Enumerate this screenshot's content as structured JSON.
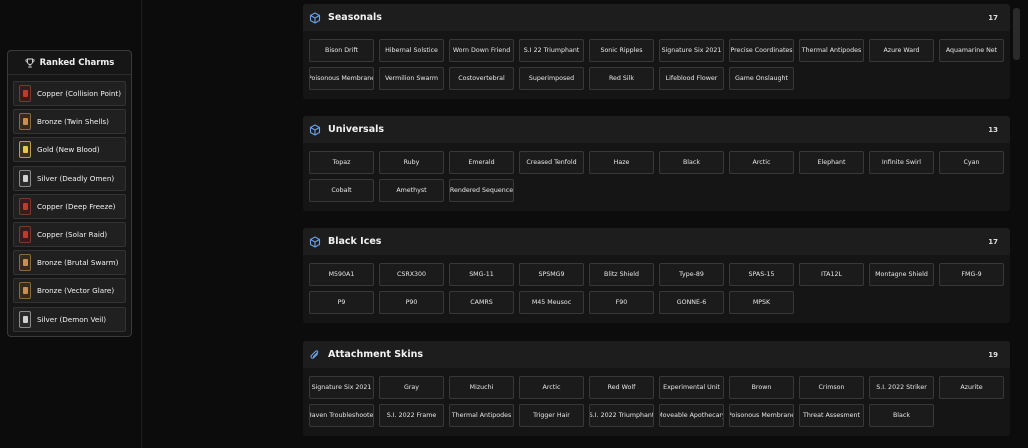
{
  "charms": {
    "title": "Ranked Charms",
    "items": [
      {
        "label": "Copper (Collision Point)",
        "tier": "copper"
      },
      {
        "label": "Bronze (Twin Shells)",
        "tier": "bronze"
      },
      {
        "label": "Gold (New Blood)",
        "tier": "gold"
      },
      {
        "label": "Silver (Deadly Omen)",
        "tier": "silver"
      },
      {
        "label": "Copper (Deep Freeze)",
        "tier": "copper"
      },
      {
        "label": "Copper (Solar Raid)",
        "tier": "copper"
      },
      {
        "label": "Bronze (Brutal Swarm)",
        "tier": "bronze"
      },
      {
        "label": "Bronze (Vector Glare)",
        "tier": "bronze"
      },
      {
        "label": "Silver (Demon Veil)",
        "tier": "silver"
      }
    ]
  },
  "sections": [
    {
      "title": "Seasonals",
      "count": "17",
      "icon": "cube-icon",
      "items": [
        "Bison Drift",
        "Hibernal Solstice",
        "Worn Down Friend",
        "S.I 22 Triumphant",
        "Sonic Ripples",
        "Signature Six 2021",
        "Precise Coordinates",
        "Thermal Antipodes",
        "Azure Ward",
        "Aquamarine Net",
        "Poisonous Membrane",
        "Vermilion Swarm",
        "Costovertebral",
        "Superimposed",
        "Red Silk",
        "Lifeblood Flower",
        "Game Onslaught"
      ]
    },
    {
      "title": "Universals",
      "count": "13",
      "icon": "cube-icon",
      "items": [
        "Topaz",
        "Ruby",
        "Emerald",
        "Creased Tenfold",
        "Haze",
        "Black",
        "Arctic",
        "Elephant",
        "Infinite Swirl",
        "Cyan",
        "Cobalt",
        "Amethyst",
        "Rendered Sequence"
      ]
    },
    {
      "title": "Black Ices",
      "count": "17",
      "icon": "cube-icon",
      "items": [
        "M590A1",
        "CSRX300",
        "SMG-11",
        "SPSMG9",
        "Blitz Shield",
        "Type-89",
        "SPAS-15",
        "ITA12L",
        "Montagne Shield",
        "FMG-9",
        "P9",
        "P90",
        "CAMRS",
        "M45 Meusoc",
        "F90",
        "GONNE-6",
        "MPSK"
      ]
    },
    {
      "title": "Attachment Skins",
      "count": "19",
      "icon": "paperclip-icon",
      "items": [
        "Signature Six 2021",
        "Gray",
        "Mizuchi",
        "Arctic",
        "Red Wolf",
        "Experimental Unit",
        "Brown",
        "Crimson",
        "S.I. 2022 Striker",
        "Azurite",
        "Haven Troubleshooter",
        "S.I. 2022 Frame",
        "Thermal Antipodes",
        "Trigger Hair",
        "S.I. 2022 Triumphant",
        "Moveable Apothecary",
        "Poisonous Membrane",
        "Threat Assesment",
        "Black"
      ]
    }
  ],
  "colors": {
    "accent": "#6aa0e0",
    "background": "#0c0c0c",
    "panel": "#151515"
  }
}
